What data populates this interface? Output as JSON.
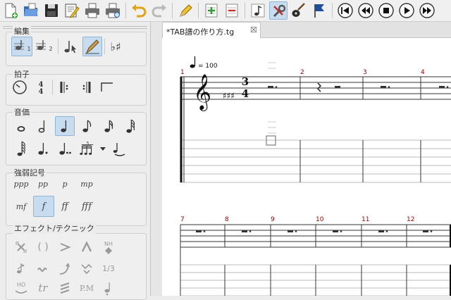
{
  "toolbar": {
    "buttons": [
      "new-file",
      "open-file",
      "save-file",
      "properties",
      "print",
      "print-preview",
      "undo",
      "redo",
      "edit-mode",
      "insert-measure",
      "remove-measure",
      "note-mode",
      "settings",
      "guitar",
      "marker",
      "first",
      "previous",
      "stop",
      "play",
      "next"
    ],
    "active": [
      "settings"
    ]
  },
  "palette": {
    "sections": {
      "edit": "編集",
      "beat": "拍子",
      "duration": "音価",
      "dynamics": "強弱記号",
      "effects": "エフェクト/テクニック"
    },
    "edit_items": [
      {
        "name": "voice-1",
        "sup": "1",
        "selected": true
      },
      {
        "name": "voice-2",
        "sup": "2",
        "selected": false
      },
      {
        "name": "select-mode",
        "selected": false
      },
      {
        "name": "edit-mode",
        "selected": true
      },
      {
        "name": "natural-sharp",
        "label": "♭♯",
        "selected": false
      }
    ],
    "duration_selected": "quarter",
    "tuplet_label": "3",
    "dynamics": [
      "ppp",
      "pp",
      "p",
      "mp",
      "mf",
      "f",
      "ff",
      "fff"
    ],
    "dynamics_selected": "f",
    "effects": {
      "row1": [
        "dead-note",
        "ghost-note",
        "accentuated",
        "heavy-accentuated",
        "harmonic"
      ],
      "harmonic_label": "NH",
      "row2": [
        "grace-note",
        "trill-wave",
        "bend",
        "tremolo-bar",
        "tuplet-fraction"
      ],
      "fraction_label": "1/3",
      "row3": [
        "hammer-on",
        "trill",
        "tremolo-picking",
        "palm-mute",
        "staccato"
      ],
      "hammer_label": "HO",
      "trill_label": "tr",
      "palm_label": "P.M"
    }
  },
  "editor": {
    "tab_title": "*TAB譜の作り方.tg",
    "close_glyph": "☒",
    "tempo": "= 100",
    "time_signature": {
      "top": "3",
      "bottom": "4"
    },
    "key": "♯ ♯ ♯",
    "measures_row1": [
      "1",
      "2",
      "3",
      "4"
    ],
    "measures_row2": [
      "7",
      "8",
      "9",
      "10",
      "11",
      "12"
    ]
  }
}
